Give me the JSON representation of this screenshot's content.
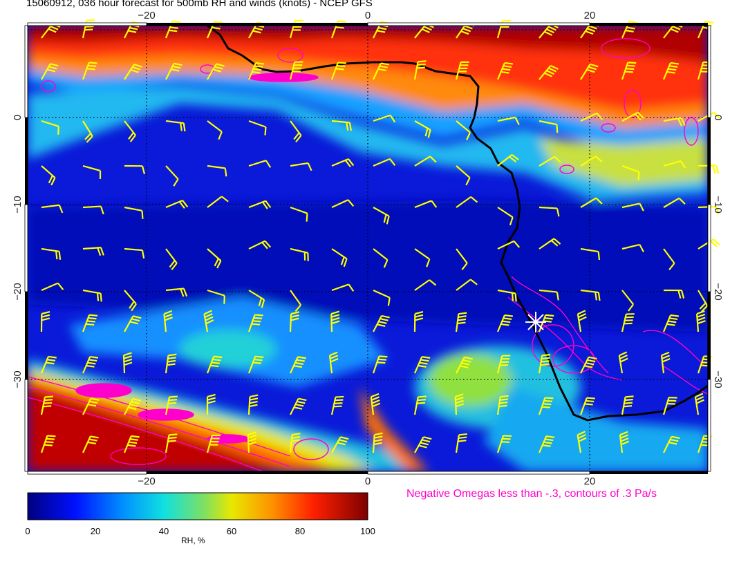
{
  "title": "15060912, 036 hour forecast for 500mb RH and winds (knots) - NCEP GFS",
  "axes": {
    "x_ticks": [
      "−20",
      "0",
      "20"
    ],
    "y_ticks": [
      "0",
      "−10",
      "−20",
      "−30"
    ],
    "lon_range": [
      -31,
      31
    ],
    "lat_range": [
      10,
      -40
    ]
  },
  "legend": {
    "omega_note": "Negative Omegas less than -.3, contours of .3 Pa/s",
    "colorbar_title": "RH, %",
    "colorbar_ticks": [
      "0",
      "20",
      "40",
      "60",
      "80",
      "100"
    ],
    "colorbar_range": [
      0,
      100
    ]
  },
  "colors": {
    "wind_barbs": "#ffff00",
    "omega_contours": "#ff00cc",
    "coastline": "#000000",
    "marker": "#ffffff"
  },
  "marker": {
    "icon": "star-marker-icon",
    "lon": 15,
    "lat": -23.5
  }
}
